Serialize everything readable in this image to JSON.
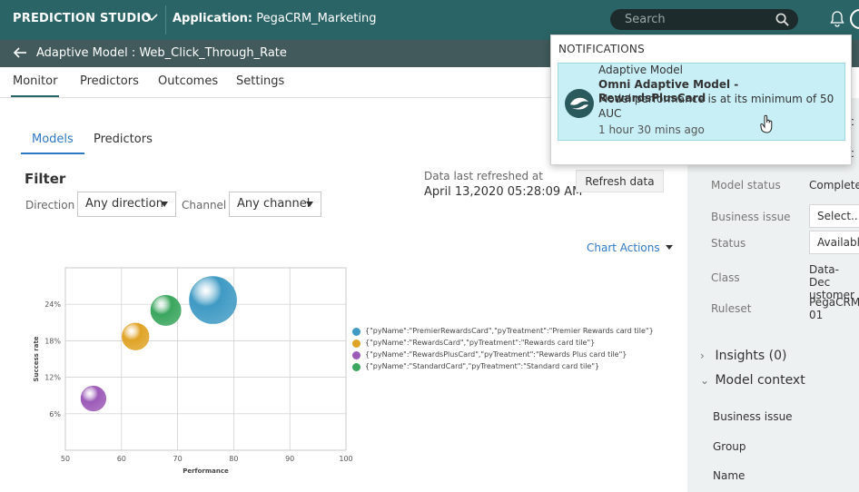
{
  "topbar": {
    "studio": "PREDICTION STUDIO",
    "app_label": "Application:",
    "app_name": "PegaCRM_Marketing",
    "search_placeholder": "Search"
  },
  "subbar": {
    "title": "Adaptive Model : Web_Click_Through_Rate"
  },
  "tabs": [
    "Monitor",
    "Predictors",
    "Outcomes",
    "Settings"
  ],
  "subtabs": [
    "Models",
    "Predictors"
  ],
  "filter": {
    "title": "Filter",
    "direction_label": "Direction",
    "direction_value": "Any direction",
    "channel_label": "Channel",
    "channel_value": "Any channel"
  },
  "refresh": {
    "label": "Data last refreshed at",
    "value": "April 13,2020 05:28:09 AM",
    "button": "Refresh data"
  },
  "chart_actions": "Chart Actions",
  "chart_data": {
    "type": "scatter",
    "xlabel": "Performance",
    "ylabel": "Success rate",
    "xlim": [
      50,
      100
    ],
    "ylim": [
      0,
      30
    ],
    "x_ticks": [
      "50",
      "60",
      "70",
      "80",
      "90",
      "100"
    ],
    "y_ticks": [
      "6%",
      "12%",
      "18%",
      "24%"
    ],
    "y_tick_values": [
      6,
      12,
      18,
      24
    ],
    "x_tick_values": [
      50,
      60,
      70,
      80,
      90,
      100
    ],
    "series": [
      {
        "name": "{\"pyName\":\"PremierRewardsCard\",\"pyTreatment\":\"Premier Rewards card tile\"}",
        "x": 76.3,
        "y": 24.7,
        "color": "#3f9ac4"
      },
      {
        "name": "{\"pyName\":\"RewardsCard\",\"pyTreatment\":\"Rewards card tile\"}",
        "x": 62.5,
        "y": 18.7,
        "color": "#e0a326"
      },
      {
        "name": "{\"pyName\":\"RewardsPlusCard\",\"pyTreatment\":\"Rewards Plus card tile\"}",
        "x": 55.0,
        "y": 8.5,
        "color": "#9c5ab8"
      },
      {
        "name": "{\"pyName\":\"StandardCard\",\"pyTreatment\":\"Standard card tile\"}",
        "x": 67.9,
        "y": 23.0,
        "color": "#3aa65e"
      }
    ],
    "bubble_sizes": [
      1.0,
      0.57,
      0.53,
      0.64
    ],
    "grid": true,
    "legend": "right"
  },
  "right_panel": {
    "model_status_label": "Model status",
    "model_status_value": "Complete",
    "business_issue_label": "Business issue",
    "business_issue_value": "Select...",
    "status_label": "Status",
    "status_value": "Availabl",
    "class_label": "Class",
    "class_value_1": "Data-Dec",
    "class_value_2": "ustomer",
    "ruleset_label": "Ruleset",
    "ruleset_value_1": "PegaCRM",
    "ruleset_value_2": "01",
    "insights": "Insights (0)",
    "model_context": "Model context",
    "context_items": [
      "Business issue",
      "Group",
      "Name"
    ],
    "clip_c1": "c",
    "clip_c2": "c"
  },
  "notifications": {
    "header": "NOTIFICATIONS",
    "category": "Adaptive Model",
    "title": "Omni Adaptive Model - RewardsPlusCard",
    "message_1": "Model performance is at its minimum of 50",
    "message_2": "AUC",
    "time": "1 hour 30 mins ago"
  }
}
